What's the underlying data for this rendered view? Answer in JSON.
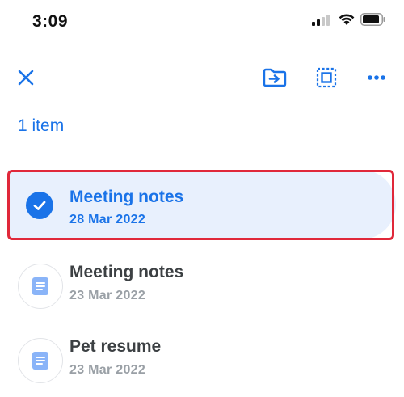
{
  "status_bar": {
    "time": "3:09",
    "icons": [
      "signal-icon",
      "wifi-icon",
      "battery-icon"
    ]
  },
  "toolbar": {
    "icons": [
      "close-icon",
      "move-to-folder-icon",
      "select-all-icon",
      "more-icon"
    ]
  },
  "selection": {
    "count_label": "1 item"
  },
  "files": [
    {
      "title": "Meeting notes",
      "date": "28 Mar 2022",
      "selected": true,
      "icon": "check-icon"
    },
    {
      "title": "Meeting notes",
      "date": "23 Mar 2022",
      "selected": false,
      "icon": "document-icon"
    },
    {
      "title": "Pet resume",
      "date": "23 Mar 2022",
      "selected": false,
      "icon": "document-icon"
    }
  ],
  "colors": {
    "accent": "#1a73e8",
    "selected_bg": "#e8f0fd",
    "highlight_border": "#e0283a",
    "secondary_text": "#9aa0a6",
    "doc_icon": "#8ab4f8"
  }
}
